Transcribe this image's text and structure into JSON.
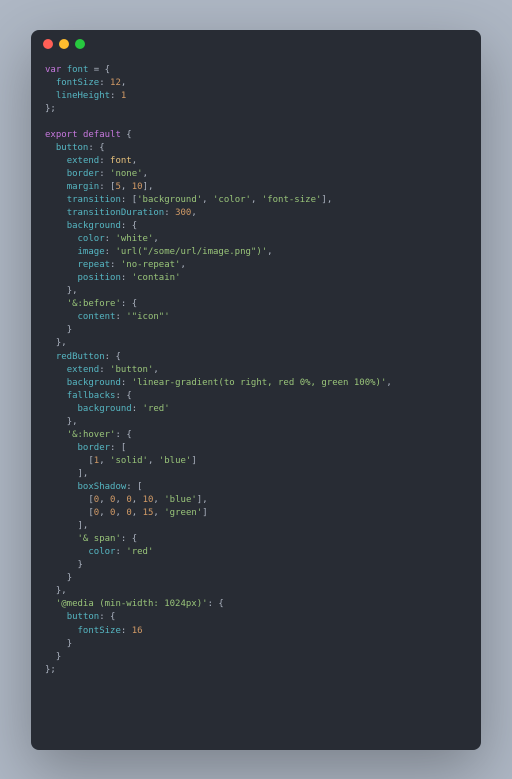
{
  "window": {
    "traffic_light_colors": [
      "#ff5f56",
      "#ffbd2e",
      "#27c93f"
    ]
  },
  "code": {
    "font": {
      "fontSize": 12,
      "lineHeight": 1
    },
    "default": {
      "button": {
        "extend": "font",
        "border": "'none'",
        "margin": [
          5,
          10
        ],
        "transition": [
          "'background'",
          "'color'",
          "'font-size'"
        ],
        "transitionDuration": 300,
        "background": {
          "color": "'white'",
          "image": "'url(\"/some/url/image.png\")'",
          "repeat": "'no-repeat'",
          "position": "'contain'"
        },
        "&:before": {
          "content": "'\"icon\"'"
        }
      },
      "redButton": {
        "extend": "'button'",
        "background": "'linear-gradient(to right, red 0%, green 100%)'",
        "fallbacks": {
          "background": "'red'"
        },
        "&:hover": {
          "border": [
            1,
            "'solid'",
            "'blue'"
          ],
          "boxShadow": [
            [
              0,
              0,
              0,
              10,
              "'blue'"
            ],
            [
              0,
              0,
              0,
              15,
              "'green'"
            ]
          ],
          "& span": {
            "color": "'red'"
          }
        }
      },
      "@media (min-width: 1024px)": {
        "button": {
          "fontSize": 16
        }
      }
    }
  }
}
